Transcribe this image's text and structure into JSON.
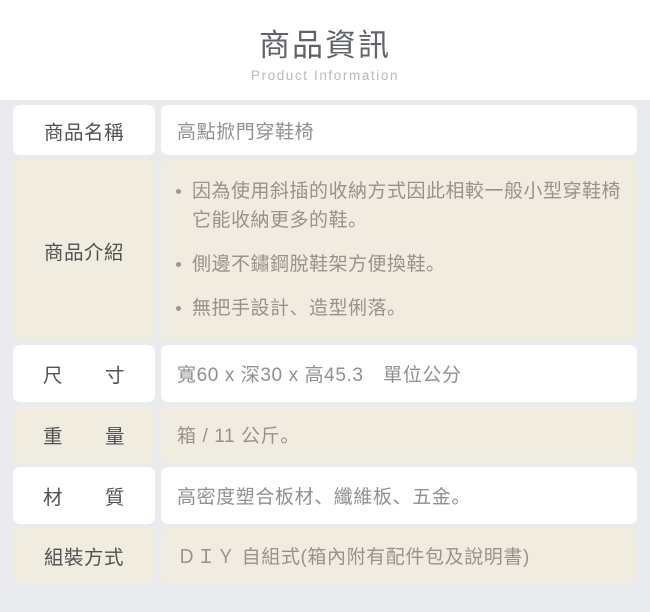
{
  "header": {
    "title_cn": "商品資訊",
    "title_en": "Product Information"
  },
  "colors": {
    "page_background": "#ffffff",
    "table_background": "#e9ebee",
    "row_light": "#ffffff",
    "row_dark": "#f1ece0",
    "label_text": "#4f5153",
    "value_text": "#8e9093",
    "value_text_dark_row": "#98938a",
    "title_text": "#5f6368",
    "subtitle_text": "#b6b9bd"
  },
  "table": {
    "rows": [
      {
        "label": "商品名稱",
        "label_style": "normal",
        "tone": "light",
        "value": "高點掀門穿鞋椅"
      },
      {
        "label": "商品介紹",
        "label_style": "normal",
        "tone": "dark",
        "bullets": [
          "因為使用斜插的收納方式因此相較一般小型穿鞋椅它能收納更多的鞋。",
          "側邊不鏽鋼脫鞋架方便換鞋。",
          "無把手設計、造型俐落。"
        ]
      },
      {
        "label": "尺寸",
        "label_style": "spread",
        "tone": "light",
        "value": "寬60 x 深30 x 高45.3　單位公分"
      },
      {
        "label": "重量",
        "label_style": "spread",
        "tone": "dark",
        "value": "箱 / 11 公斤。"
      },
      {
        "label": "材質",
        "label_style": "spread",
        "tone": "light",
        "value": "高密度塑合板材、纖維板、五金。"
      },
      {
        "label": "組裝方式",
        "label_style": "normal",
        "tone": "dark",
        "value": "ＤＩＹ 自組式(箱內附有配件包及說明書)"
      }
    ]
  }
}
